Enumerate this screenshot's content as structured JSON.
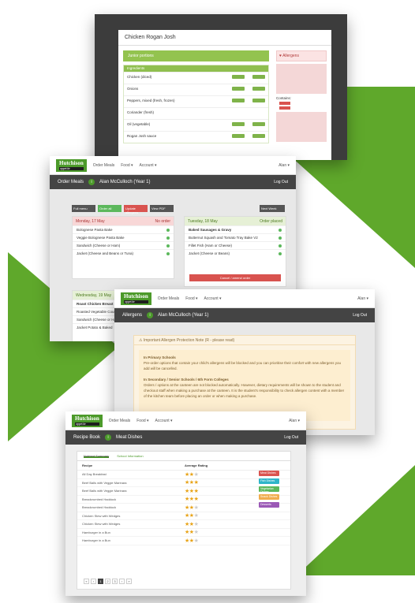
{
  "colors": {
    "brand_green": "#5fa82b",
    "logo_green": "#4c9a2a",
    "dark_bar": "#444444",
    "danger": "#d9534f"
  },
  "logo": {
    "name": "Hutchison",
    "sub": "appetite"
  },
  "nav": {
    "order_meals": "Order Meals",
    "food": "Food ▾",
    "account": "Account ▾",
    "user": "Alan ▾"
  },
  "recipe_modal": {
    "title": "Chicken Rogan Josh",
    "portion_label": "Junior portions",
    "table_header": "Ingredients",
    "ingredients": [
      "Chicken (diced)",
      "Onions",
      "Peppers, mixed (fresh, frozen)",
      "Coriander (fresh)",
      "Oil (vegetable)",
      "Rogan Josh sauce"
    ],
    "allergens_title": "Allergens",
    "allergens_note": "Contains:"
  },
  "order_screen": {
    "title": "Order Meals",
    "user": "Alan McCulloch (Year 1)",
    "logout": "Log Out",
    "buttons": [
      "Full menu",
      "Order all",
      "Update allergens",
      "View PDF"
    ],
    "next_week": "Next Week",
    "monday": {
      "day": "Monday, 17 May",
      "status": "No order",
      "items": [
        "Bolognese Pasta Bake",
        "Veggie Bolognese Pasta Bake",
        "Sandwich (Cheese or Ham)",
        "Jacket (Cheese and Beans or Tuna)"
      ]
    },
    "tuesday": {
      "day": "Tuesday, 18 May",
      "status": "Order placed",
      "items": [
        "Baked Sausages & Gravy",
        "Butternut Squash and Tomato Tray Bake V2",
        "Fillet Fish (Ham or Cheese)",
        "Jacket (Cheese or Beans)"
      ],
      "cancel": "Cancel / amend order"
    },
    "wednesday": {
      "day": "Wednesday, 19 May",
      "items": [
        "Roast Chicken Breast",
        "Roasted Vegetable Cous",
        "Sandwich (Cheese or Ham)",
        "Jacket Potato & Baked"
      ]
    }
  },
  "allergen_screen": {
    "title": "Allergens",
    "user": "Alan McCulloch (Year 1)",
    "logout": "Log Out",
    "warning_title": "Important Allergen Protection Note (R - please read)",
    "primary_title": "In Primary Schools",
    "primary_text": "Pre-order options that contain your child's allergens will be blocked and you can prioritise their comfort with new allergens you add will be cancelled.",
    "secondary_title": "In Secondary / Senior Schools / 6th Form Colleges",
    "secondary_text": "Orders / options at the canteen are not blocked automatically. However, dietary requirements will be shown to the student and checkout staff when making a purchase at the canteen. It is the student's responsibility to check allergen content with a member of the kitchen team before placing an order or when making a purchase."
  },
  "recipe_screen": {
    "title": "Recipe Book",
    "section": "Meat Dishes",
    "logout": "Log Out",
    "tabs": [
      "Nutrient Summary",
      "School Information"
    ],
    "col_name": "Recipe",
    "col_rating": "Average Rating",
    "rows": [
      {
        "name": "All Day Breakfast",
        "rating": 2
      },
      {
        "name": "Beef Balls with Veggie Marinara",
        "rating": 3
      },
      {
        "name": "Beef Balls with Veggie Marinara",
        "rating": 3
      },
      {
        "name": "Breadcrumbed Haddock",
        "rating": 3
      },
      {
        "name": "Breadcrumbed Haddock",
        "rating": 2
      },
      {
        "name": "Chicken Stew with Wedges",
        "rating": 2
      },
      {
        "name": "Chicken Stew with Wedges",
        "rating": 2
      },
      {
        "name": "Hamburger in a Bun",
        "rating": 2
      },
      {
        "name": "Hamburger in a Bun",
        "rating": 2
      }
    ],
    "filters": [
      {
        "label": "Meat Dishes",
        "color": "#d9534f"
      },
      {
        "label": "Fish Dishes",
        "color": "#2fb5c9"
      },
      {
        "label": "Vegetarian Dishes",
        "color": "#5cb85c"
      },
      {
        "label": "Snack Dishes",
        "color": "#f0ad4e"
      },
      {
        "label": "Desserts",
        "color": "#9b59b6"
      }
    ],
    "pager": [
      "«",
      "‹",
      "1",
      "2",
      "3",
      "›",
      "»"
    ]
  }
}
